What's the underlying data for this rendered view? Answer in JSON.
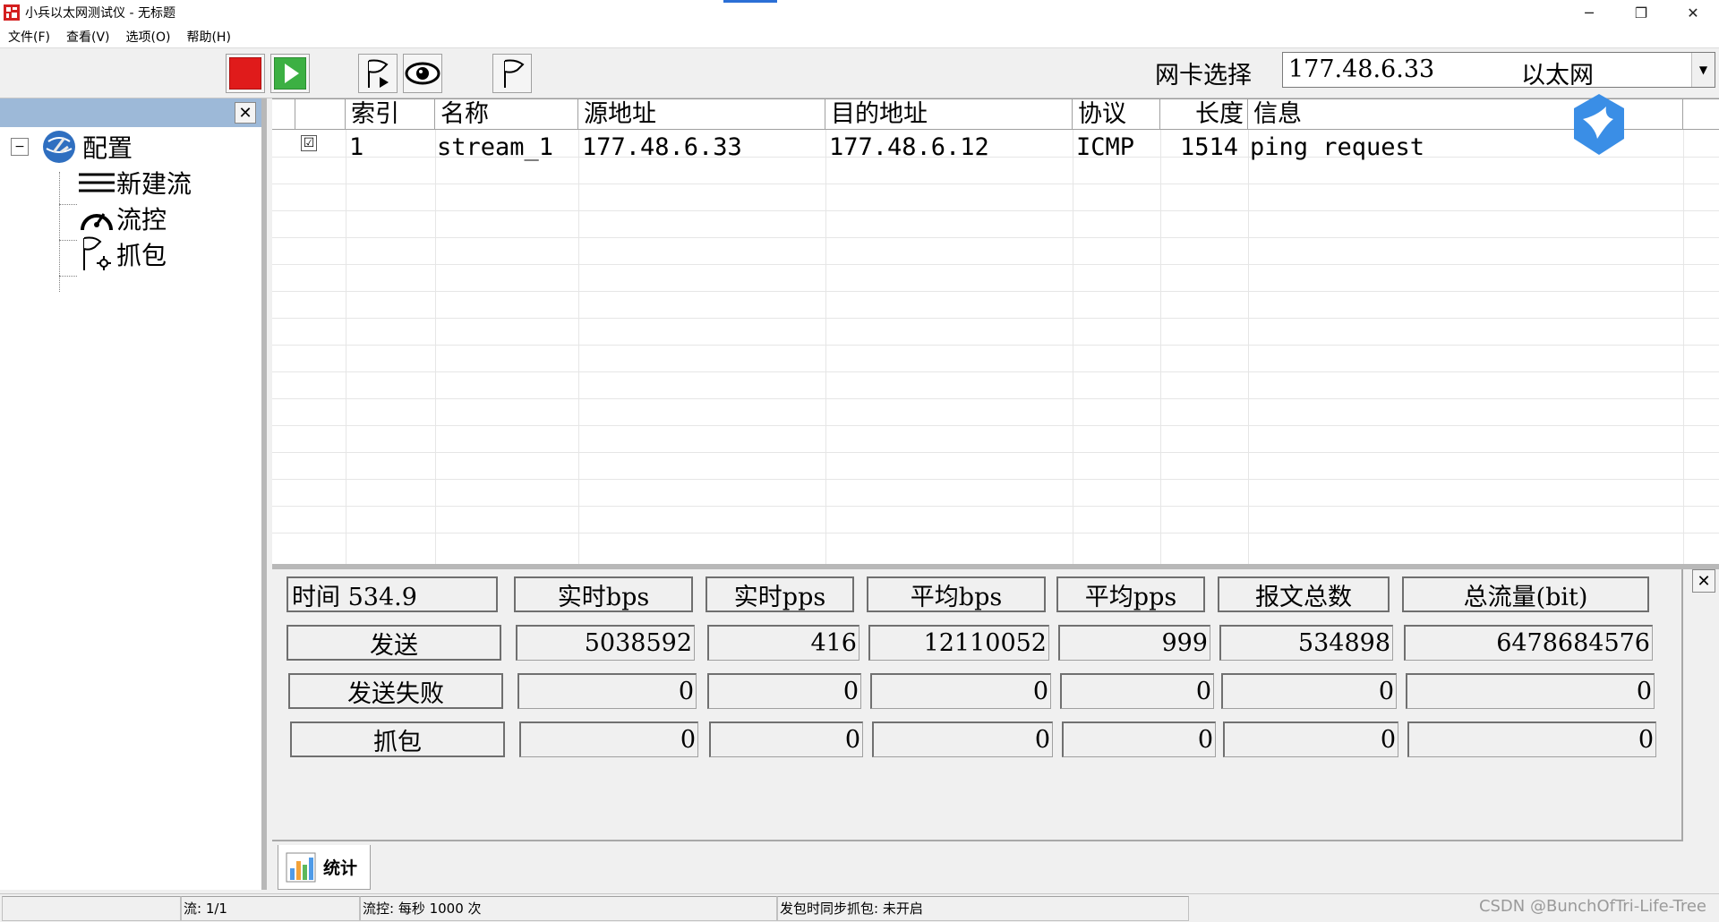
{
  "window": {
    "title": "小兵以太网测试仪 - 无标题"
  },
  "menu": [
    "文件(F)",
    "查看(V)",
    "选项(O)",
    "帮助(H)"
  ],
  "toolbar": {
    "nic_label": "网卡选择",
    "nic_ip": "177.48.6.33",
    "nic_type": "以太网"
  },
  "tree": {
    "root": "配置",
    "children": [
      "新建流",
      "流控",
      "抓包"
    ]
  },
  "grid": {
    "columns": [
      "索引",
      "名称",
      "源地址",
      "目的地址",
      "协议",
      "长度",
      "信息"
    ],
    "rows": [
      {
        "checked": "☑",
        "index": "1",
        "name": "stream_1",
        "src": "177.48.6.33",
        "dst": "177.48.6.12",
        "protocol": "ICMP",
        "length": "1514",
        "info": "ping request"
      }
    ]
  },
  "stats": {
    "time_label": "时间 534.9",
    "headers": [
      "实时bps",
      "实时pps",
      "平均bps",
      "平均pps",
      "报文总数",
      "总流量(bit)"
    ],
    "rows": [
      {
        "label": "发送",
        "values": [
          "5038592",
          "416",
          "12110052",
          "999",
          "534898",
          "6478684576"
        ]
      },
      {
        "label": "发送失败",
        "values": [
          "0",
          "0",
          "0",
          "0",
          "0",
          "0"
        ]
      },
      {
        "label": "抓包",
        "values": [
          "0",
          "0",
          "0",
          "0",
          "0",
          "0"
        ]
      }
    ],
    "tab_label": "统计"
  },
  "statusbar": {
    "seg1": "",
    "flows": "流: 1/1",
    "flow_control": "流控: 每秒 1000 次",
    "sync_capture": "发包时同步抓包: 未开启",
    "watermark": "CSDN @BunchOfTri-Life-Tree"
  },
  "colors": {
    "stop": "#e01b1b",
    "play": "#3cb043",
    "panel_header": "#9db9d8",
    "bird": "#3a8ee6"
  }
}
